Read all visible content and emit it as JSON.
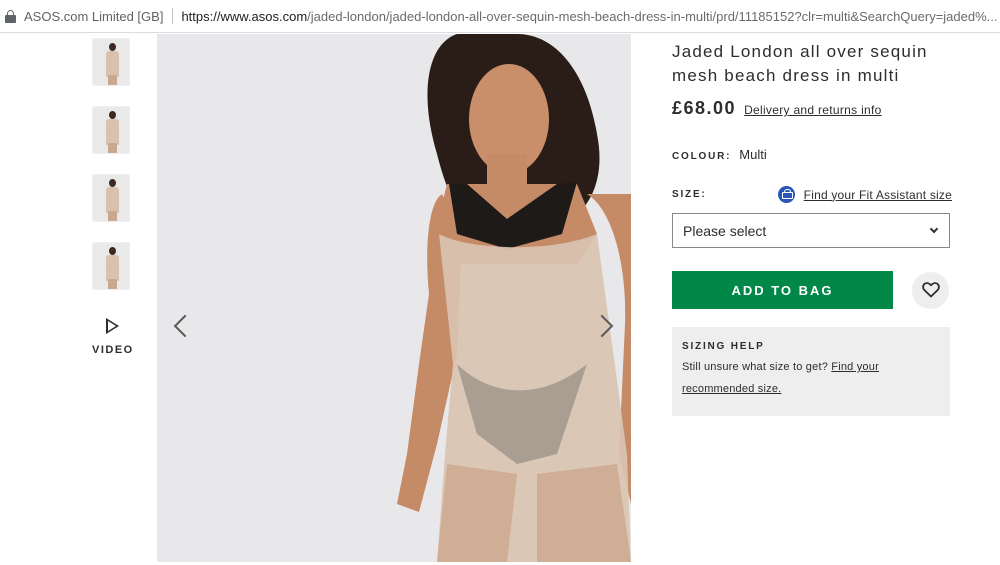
{
  "address_bar": {
    "site_name": "ASOS.com Limited [GB]",
    "url_host": "https://www.asos.com",
    "url_path": "/jaded-london/jaded-london-all-over-sequin-mesh-beach-dress-in-multi/prd/11185152?clr=multi&SearchQuery=jaded%..."
  },
  "gallery": {
    "thumbnail_count": 4,
    "video_label": "VIDEO"
  },
  "product": {
    "title": "Jaded London all over sequin mesh beach dress in multi",
    "price": "£68.00",
    "delivery_link": "Delivery and returns info",
    "colour_label": "COLOUR:",
    "colour_value": "Multi",
    "size_label": "SIZE:",
    "fit_assistant_link": "Find your Fit Assistant size",
    "size_placeholder": "Please select",
    "add_to_bag": "ADD TO BAG"
  },
  "sizing_help": {
    "title": "SIZING HELP",
    "text": "Still unsure what size to get? ",
    "link_part1": "Find your",
    "link_part2": "recommended size."
  },
  "colors": {
    "add_to_bag_bg": "#018849",
    "fit_icon": "#2a55b8",
    "panel_bg": "#eeeeee"
  }
}
